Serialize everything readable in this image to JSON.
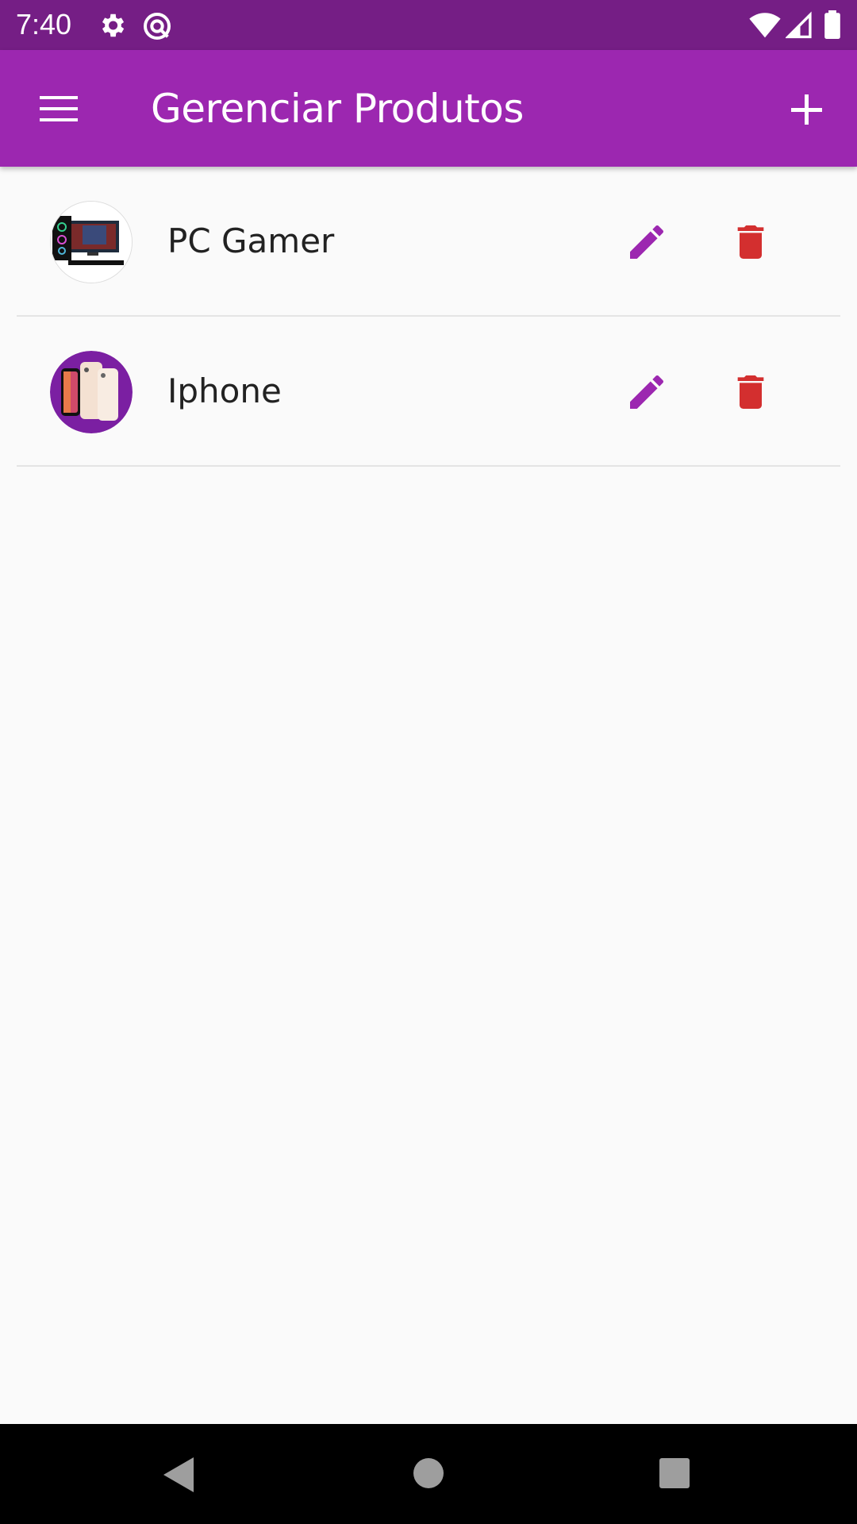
{
  "status_bar": {
    "time": "7:40",
    "icons": [
      "settings-icon",
      "data-saver-icon",
      "wifi-icon",
      "signal-icon",
      "battery-icon"
    ]
  },
  "app_bar": {
    "title": "Gerenciar Produtos",
    "menu_icon": "menu-icon",
    "add_icon": "add-icon"
  },
  "products": [
    {
      "name": "PC Gamer",
      "image": "pc-gamer-thumbnail"
    },
    {
      "name": "Iphone",
      "image": "iphone-thumbnail"
    }
  ],
  "nav_bar": {
    "icons": [
      "back-icon",
      "home-icon",
      "recents-icon"
    ]
  },
  "colors": {
    "status_bar": "#751e85",
    "primary": "#9c27b0",
    "edit_icon": "#9c27b0",
    "delete_icon": "#d32f2f",
    "background": "#fafafa"
  }
}
